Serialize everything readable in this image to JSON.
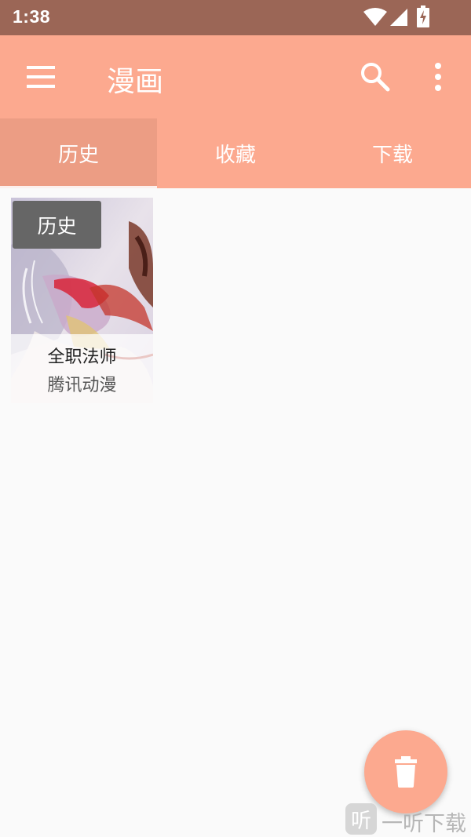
{
  "status_bar": {
    "time": "1:38",
    "icons": [
      "wifi-icon",
      "cellular-signal-icon",
      "battery-charging-icon"
    ]
  },
  "toolbar": {
    "title": "漫画",
    "menu_icon": "hamburger-menu-icon",
    "search_icon": "search-icon",
    "more_icon": "more-vertical-icon"
  },
  "tabs": [
    {
      "label": "历史",
      "active": true
    },
    {
      "label": "收藏",
      "active": false
    },
    {
      "label": "下载",
      "active": false
    }
  ],
  "comics": [
    {
      "badge": "历史",
      "title": "全职法师",
      "source": "腾讯动漫"
    }
  ],
  "fab": {
    "icon": "trash-icon"
  },
  "watermark": {
    "logo": "听",
    "text": "一听下载"
  },
  "colors": {
    "status_bar": "#9b6656",
    "primary": "#fca98f",
    "tab_active": "#ec9d84",
    "background": "#fafafa"
  }
}
